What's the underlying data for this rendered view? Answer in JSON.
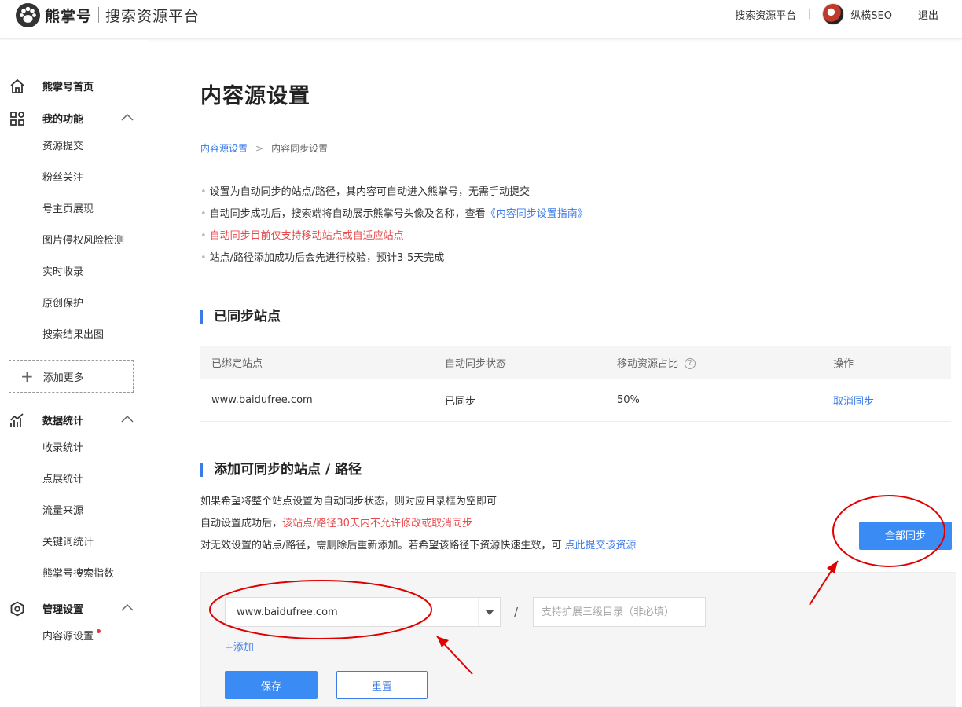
{
  "header": {
    "brand": "熊掌号",
    "platform": "搜索资源平台",
    "nav_platform": "搜索资源平台",
    "username": "纵横SEO",
    "logout": "退出"
  },
  "sidebar": {
    "home": "熊掌号首页",
    "my_functions": {
      "label": "我的功能",
      "items": [
        "资源提交",
        "粉丝关注",
        "号主页展现",
        "图片侵权风险检测",
        "实时收录",
        "原创保护",
        "搜索结果出图"
      ]
    },
    "add_more": "添加更多",
    "stats": {
      "label": "数据统计",
      "items": [
        "收录统计",
        "点展统计",
        "流量来源",
        "关键词统计",
        "熊掌号搜索指数"
      ]
    },
    "manage": {
      "label": "管理设置",
      "items": [
        "内容源设置"
      ]
    }
  },
  "main": {
    "title": "内容源设置",
    "breadcrumb": {
      "root": "内容源设置",
      "current": "内容同步设置"
    },
    "notes": {
      "n1": "设置为自动同步的站点/路径，其内容可自动进入熊掌号，无需手动提交",
      "n2_prefix": "自动同步成功后，搜索端将自动展示熊掌号头像及名称，查看",
      "n2_link": "《内容同步设置指南》",
      "n3": "自动同步目前仅支持移动站点或自适应站点",
      "n4": "站点/路径添加成功后会先进行校验，预计3-5天完成"
    },
    "synced_section": {
      "title": "已同步站点",
      "columns": [
        "已绑定站点",
        "自动同步状态",
        "移动资源占比",
        "操作"
      ],
      "help_icon": "?",
      "rows": [
        {
          "site": "www.baidufree.com",
          "status": "已同步",
          "ratio": "50%",
          "action": "取消同步"
        }
      ]
    },
    "add_section": {
      "title": "添加可同步的站点 / 路径",
      "line1": "如果希望将整个站点设置为自动同步状态，则对应目录框为空即可",
      "line2_prefix": "自动设置成功后，",
      "line2_red": "该站点/路径30天内不允许修改或取消同步",
      "line3_prefix": "对无效设置的站点/路径，需删除后重新添加。若希望该路径下资源快速生效，可 ",
      "line3_link": "点此提交该资源",
      "sync_all_button": "全部同步",
      "site_select_value": "www.baidufree.com",
      "slash": "/",
      "path_placeholder": "支持扩展三级目录（非必填）",
      "add_link": "+添加",
      "save_button": "保存",
      "reset_button": "重置"
    }
  },
  "colors": {
    "accent": "#3b8bf5",
    "link": "#3b7be8",
    "warning": "#e84b4b",
    "annotation": "#e00000"
  }
}
